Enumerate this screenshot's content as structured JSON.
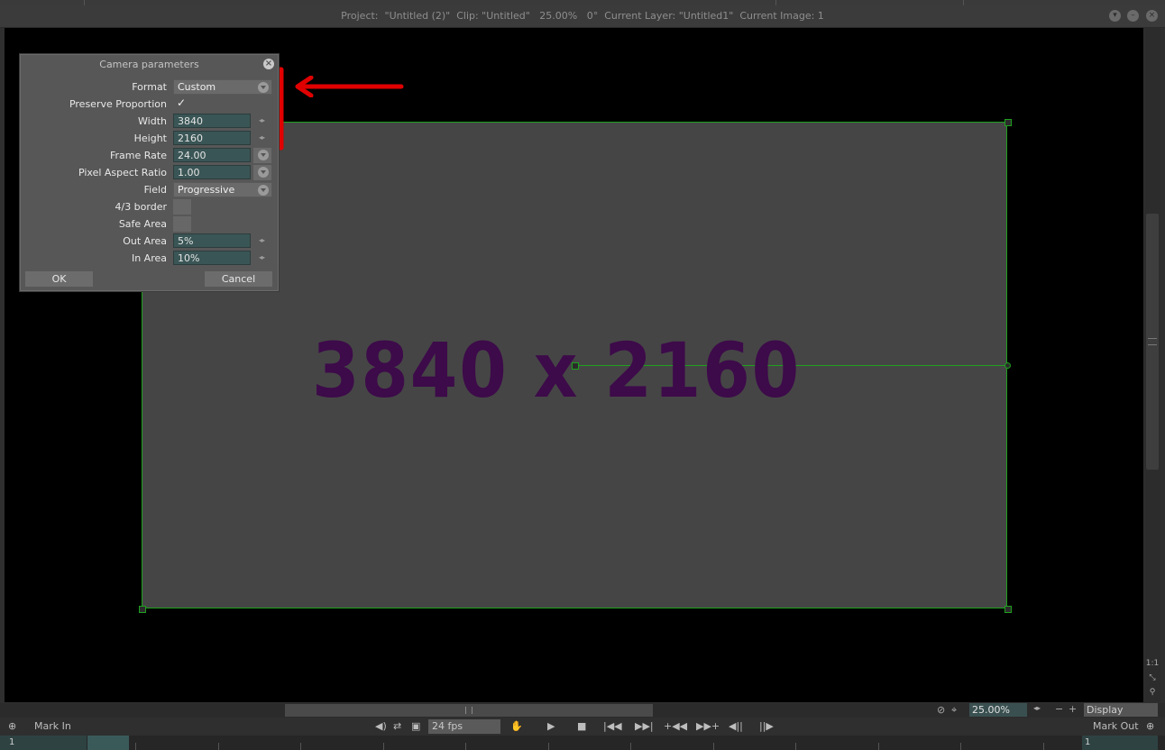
{
  "window": {
    "title": "Project:  \"Untitled (2)\"  Clip: \"Untitled\"   25.00%   0°  Current Layer: \"Untitled1\"  Current Image: 1"
  },
  "canvas": {
    "overlay_text": "3840 x 2160",
    "overlay_color": "#3d0a4a",
    "border_color": "#1ea01e"
  },
  "dialog": {
    "title": "Camera parameters",
    "format_label": "Format",
    "format_value": "Custom",
    "preserve_label": "Preserve Proportion",
    "preserve_checked": true,
    "width_label": "Width",
    "width_value": "3840",
    "height_label": "Height",
    "height_value": "2160",
    "framerate_label": "Frame Rate",
    "framerate_value": "24.00",
    "par_label": "Pixel Aspect Ratio",
    "par_value": "1.00",
    "field_label": "Field",
    "field_value": "Progressive",
    "border43_label": "4/3 border",
    "safearea_label": "Safe Area",
    "outarea_label": "Out Area",
    "outarea_value": "5%",
    "inarea_label": "In Area",
    "inarea_value": "10%",
    "ok_label": "OK",
    "cancel_label": "Cancel"
  },
  "annotation": {
    "color": "#e00000"
  },
  "viewer_tools": {
    "ratio_label": "1:1"
  },
  "bottom": {
    "zoom_value": "25.00%",
    "display_label": "Display",
    "mark_in_label": "Mark In",
    "mark_out_label": "Mark Out",
    "fps_value": "24 fps",
    "start_frame": "1",
    "end_frame": "1"
  }
}
